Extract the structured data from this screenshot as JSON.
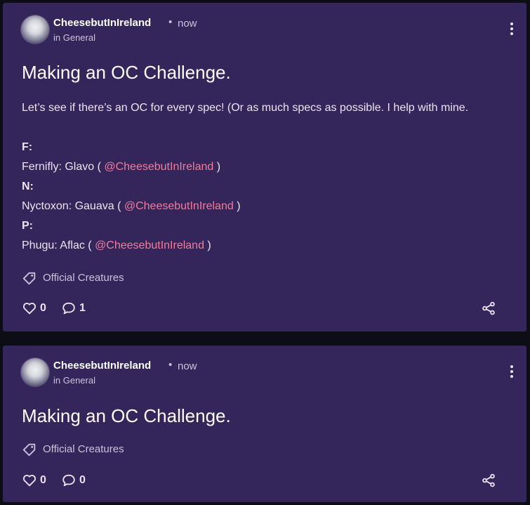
{
  "posts": [
    {
      "author": "CheesebutInIreland",
      "separator": "•",
      "time": "now",
      "community": "in General",
      "title": "Making an OC Challenge.",
      "intro": "Let’s see if there’s an OC for every spec! (Or as much specs as possible. I help with mine.",
      "sections": [
        {
          "heading": "F:",
          "line_prefix": "Fernifly: Glavo ( ",
          "mention": "@CheesebutInIreland",
          "line_suffix": " )"
        },
        {
          "heading": "N:",
          "line_prefix": "Nyctoxon: Gauava ( ",
          "mention": "@CheesebutInIreland",
          "line_suffix": " )"
        },
        {
          "heading": "P:",
          "line_prefix": "Phugu: Aflac ( ",
          "mention": "@CheesebutInIreland",
          "line_suffix": " )"
        }
      ],
      "tag": "Official Creatures",
      "likes": "0",
      "comments": "1"
    },
    {
      "author": "CheesebutInIreland",
      "separator": "•",
      "time": "now",
      "community": "in General",
      "title": "Making an OC Challenge.",
      "tag": "Official Creatures",
      "likes": "0",
      "comments": "0"
    }
  ],
  "icons": {
    "options": "more-vertical-icon",
    "tag": "tag-icon",
    "like": "heart-icon",
    "comment": "comment-icon",
    "share": "share-icon"
  },
  "colors": {
    "card_background": "#34265a",
    "page_background": "#0d0d16",
    "mention": "#f17c9b",
    "muted_text": "#c9c3dd"
  }
}
